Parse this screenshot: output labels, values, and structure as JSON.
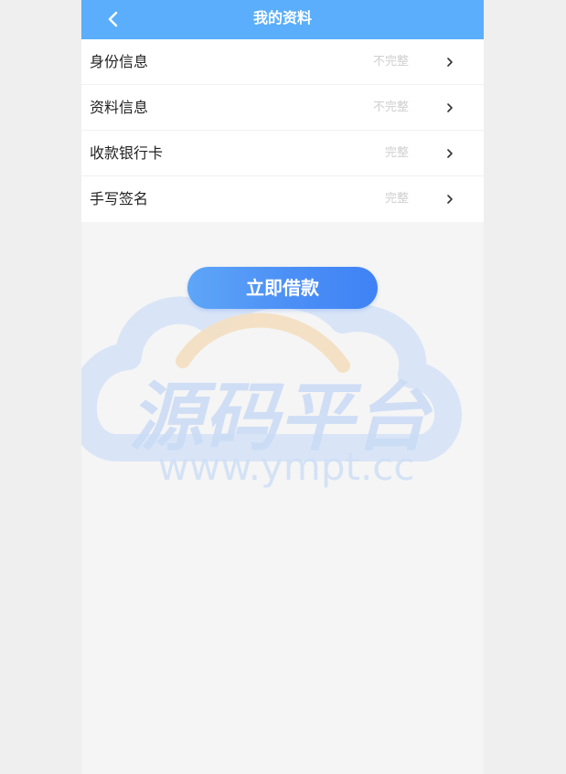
{
  "header": {
    "title": "我的资料",
    "back_icon": "chevron-left-icon"
  },
  "profile_items": [
    {
      "label": "身份信息",
      "status": "不完整"
    },
    {
      "label": "资料信息",
      "status": "不完整"
    },
    {
      "label": "收款银行卡",
      "status": "完整"
    },
    {
      "label": "手写签名",
      "status": "完整"
    }
  ],
  "loan_button": {
    "label": "立即借款"
  },
  "watermark": {
    "title": "源码平台",
    "url": "www.ympt.cc"
  },
  "colors": {
    "header_bg": "#5aaefb",
    "button_accent": "#4b8ff6",
    "status_text": "#cfcfcf"
  }
}
